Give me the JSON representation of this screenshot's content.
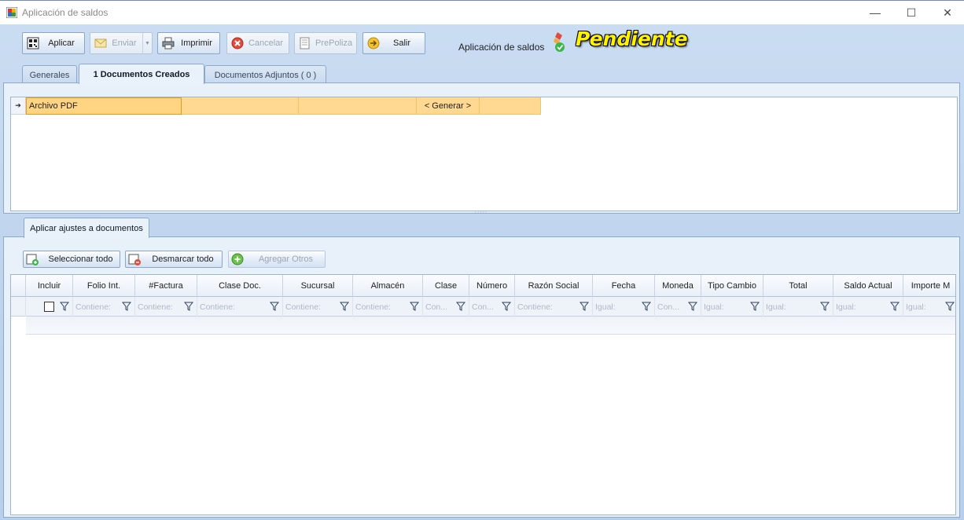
{
  "window": {
    "title": "Aplicación de saldos",
    "minimize": "—",
    "maximize": "☐",
    "close": "✕"
  },
  "toolbar": {
    "aplicar": "Aplicar",
    "enviar": "Enviar",
    "imprimir": "Imprimir",
    "cancelar": "Cancelar",
    "prepoliza": "PrePoliza",
    "salir": "Salir"
  },
  "status": {
    "label": "Aplicación de saldos",
    "value": "Pendiente",
    "value_color": "#fff200"
  },
  "tabs": [
    {
      "label": "Generales"
    },
    {
      "label": "1 Documentos Creados"
    },
    {
      "label": "Documentos Adjuntos ( 0 )"
    }
  ],
  "documents_grid": {
    "row": {
      "file": "Archivo PDF",
      "col2": "",
      "col3": "",
      "action": "< Generar >",
      "col5": ""
    }
  },
  "lower_tab": {
    "label": "Aplicar ajustes a documentos"
  },
  "actions": {
    "select_all": "Seleccionar todo",
    "deselect_all": "Desmarcar todo",
    "add_others": "Agregar Otros"
  },
  "grid": {
    "columns": [
      "Incluir",
      "Folio Int.",
      "#Factura",
      "Clase Doc.",
      "Sucursal",
      "Almacén",
      "Clase",
      "Número",
      "Razón Social",
      "Fecha",
      "Moneda",
      "Tipo Cambio",
      "Total",
      "Saldo Actual",
      "Importe M"
    ],
    "filters": [
      "",
      "Contiene:",
      "Contiene:",
      "Contiene:",
      "Contiene:",
      "Contiene:",
      "Con...",
      "Con...",
      "Contiene:",
      "Igual:",
      "Con...",
      "Igual:",
      "Igual:",
      "Igual:",
      "Igual:"
    ]
  },
  "colors": {
    "accent": "#ffd891",
    "selected_border": "#e49a1e",
    "header_bg": "#b9d1ea"
  }
}
